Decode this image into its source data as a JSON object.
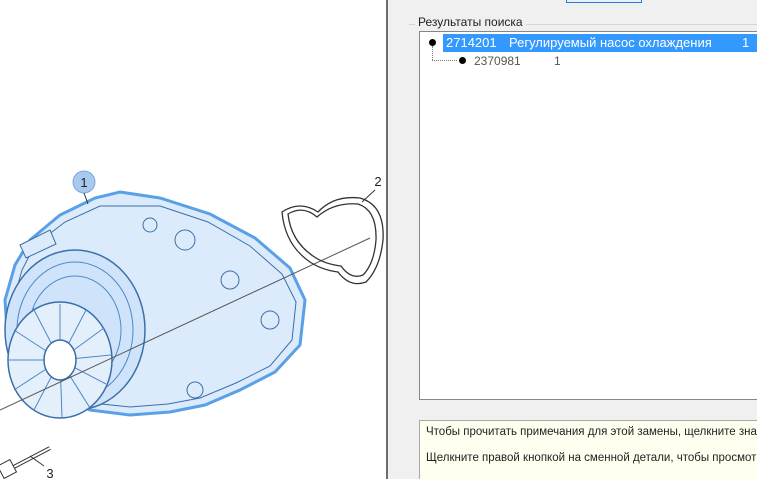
{
  "diagram": {
    "callouts": [
      "1",
      "2",
      "3"
    ]
  },
  "results": {
    "group_label": "Результаты поиска",
    "rows": [
      {
        "part_number": "2714201",
        "description": "Регулируемый насос охлаждения",
        "qty": "1",
        "selected": true
      },
      {
        "part_number": "2370981",
        "description": "",
        "qty": "1",
        "selected": false
      }
    ]
  },
  "hint": {
    "line1": "Чтобы прочитать примечания для этой замены, щелкните значок",
    "line2": "Щелкните правой кнопкой на сменной детали, чтобы просмотреть"
  },
  "colors": {
    "selection": "#3399ff",
    "highlight_part": "#5aa0e6",
    "hint_background": "#fffff0"
  }
}
